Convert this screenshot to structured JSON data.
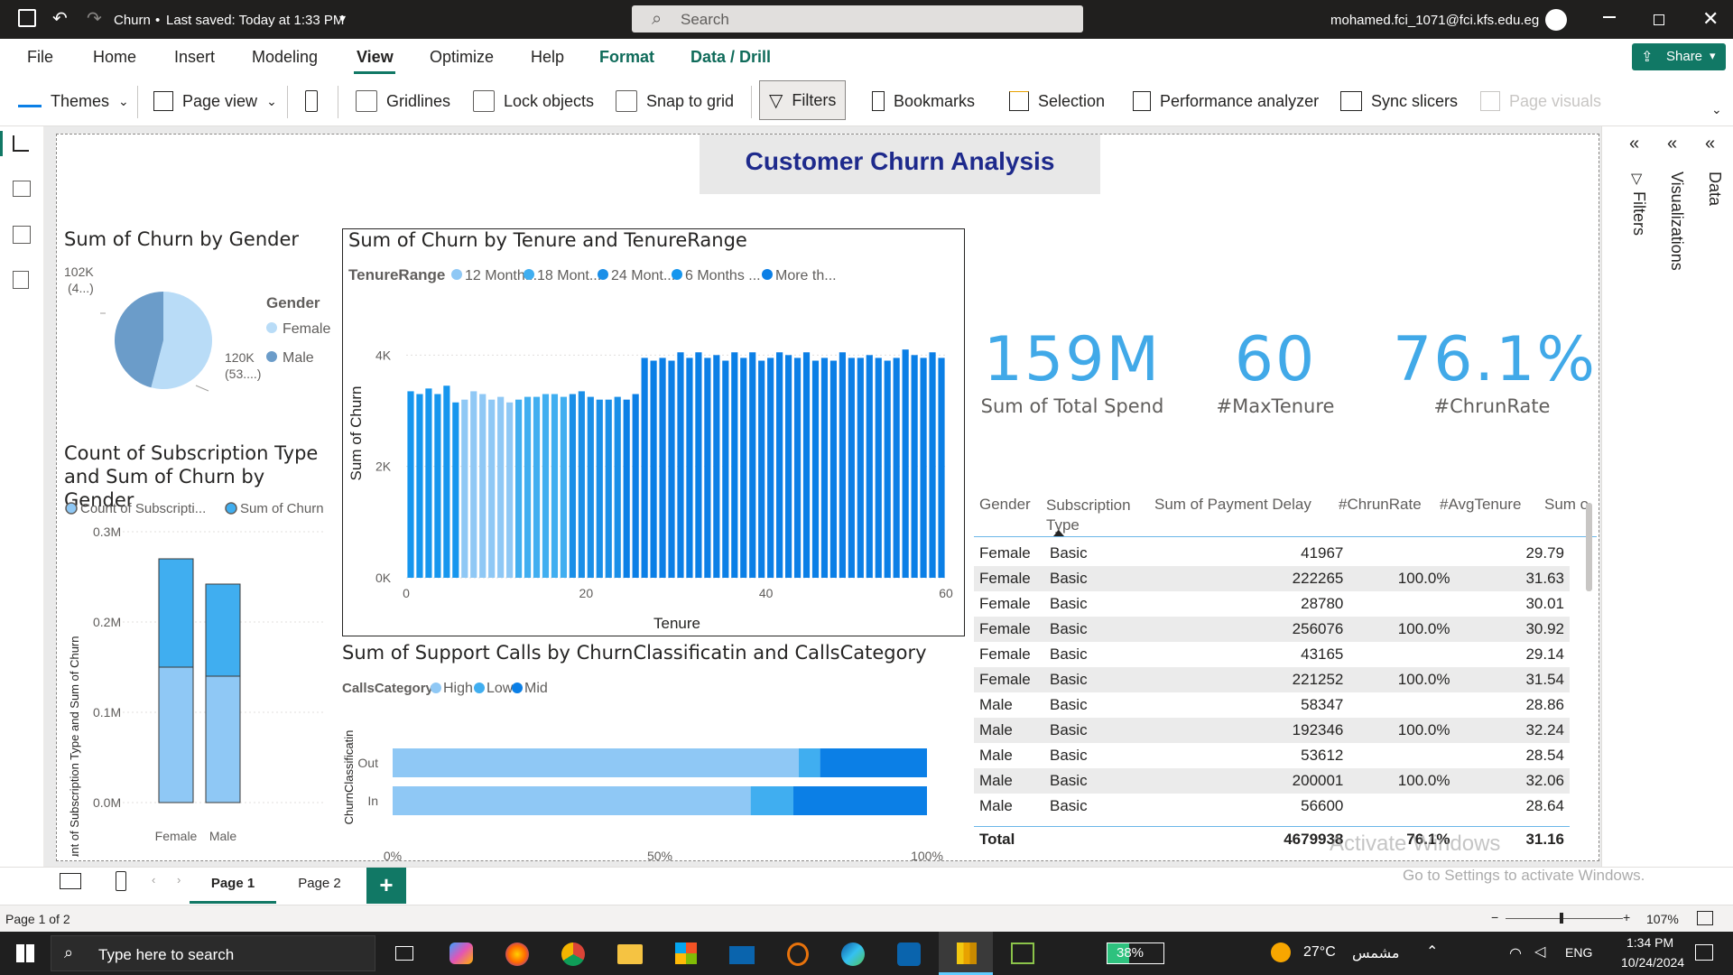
{
  "titlebar": {
    "doc_title": "Churn",
    "saved": "Last saved: Today at 1:33 PM",
    "search_placeholder": "Search",
    "account": "mohamed.fci_1071@fci.kfs.edu.eg"
  },
  "menu": {
    "items": [
      "File",
      "Home",
      "Insert",
      "Modeling",
      "View",
      "Optimize",
      "Help",
      "Format",
      "Data / Drill"
    ],
    "active": "View",
    "share": "Share"
  },
  "ribbon": {
    "themes": "Themes",
    "page_view": "Page view",
    "gridlines": "Gridlines",
    "lock_objects": "Lock objects",
    "snap_to_grid": "Snap to grid",
    "filters": "Filters",
    "bookmarks": "Bookmarks",
    "selection": "Selection",
    "performance_analyzer": "Performance analyzer",
    "sync_slicers": "Sync slicers",
    "page_visuals": "Page visuals"
  },
  "panes": {
    "filters": "Filters",
    "visualizations": "Visualizations",
    "data": "Data"
  },
  "report": {
    "title": "Customer Churn Analysis"
  },
  "cards": [
    {
      "value": "159M",
      "label": "Sum of Total Spend"
    },
    {
      "value": "60",
      "label": "#MaxTenure"
    },
    {
      "value": "76.1%",
      "label": "#ChrunRate"
    }
  ],
  "colors": {
    "light_blue": "#8fc8f5",
    "mid_blue": "#40aef0",
    "blue": "#1a8fe8",
    "deep_blue": "#0b7fe6",
    "pie_female": "#b9dcf7",
    "pie_male": "#6b9cc9",
    "card_value": "#41a9e8",
    "header_green": "#117865"
  },
  "chart_data": [
    {
      "type": "pie",
      "title": "Sum of Churn by Gender",
      "legend_title": "Gender",
      "legend_position": "right",
      "categories": [
        "Female",
        "Male"
      ],
      "values": [
        120000,
        102000
      ],
      "data_labels": [
        "120K (53....)",
        "102K (4...)"
      ]
    },
    {
      "type": "bar",
      "title": "Count of Subscription Type and Sum of Churn by Gender",
      "stacked": true,
      "legend_position": "top-left",
      "categories": [
        "Female",
        "Male"
      ],
      "series": [
        {
          "name": "Count of Subscripti...",
          "values": [
            150000,
            140000
          ]
        },
        {
          "name": "Sum of Churn",
          "values": [
            120000,
            102000
          ]
        }
      ],
      "ylabel": "Count of Subscription Type and Sum of Churn",
      "yticks": [
        "0.0M",
        "0.1M",
        "0.2M",
        "0.3M"
      ],
      "ylim": [
        0,
        300000
      ]
    },
    {
      "type": "bar",
      "title": "Sum of Churn by Tenure and TenureRange",
      "legend_title": "TenureRange",
      "legend_position": "top-left",
      "legend": [
        "12 Month...",
        "18 Mont...",
        "24 Mont...",
        "6 Months ...",
        "More th..."
      ],
      "xlabel": "Tenure",
      "ylabel": "Sum of Churn",
      "xticks": [
        "0",
        "20",
        "40",
        "60"
      ],
      "yticks": [
        "0K",
        "2K",
        "4K"
      ],
      "ylim": [
        0,
        4800
      ],
      "xlim": [
        0,
        60
      ],
      "x": [
        1,
        2,
        3,
        4,
        5,
        6,
        7,
        8,
        9,
        10,
        11,
        12,
        13,
        14,
        15,
        16,
        17,
        18,
        19,
        20,
        21,
        22,
        23,
        24,
        25,
        26,
        27,
        28,
        29,
        30,
        31,
        32,
        33,
        34,
        35,
        36,
        37,
        38,
        39,
        40,
        41,
        42,
        43,
        44,
        45,
        46,
        47,
        48,
        49,
        50,
        51,
        52,
        53,
        54,
        55,
        56,
        57,
        58,
        59,
        60
      ],
      "values": [
        3350,
        3300,
        3400,
        3300,
        3450,
        3150,
        3200,
        3350,
        3300,
        3200,
        3250,
        3150,
        3200,
        3250,
        3250,
        3300,
        3300,
        3250,
        3300,
        3350,
        3250,
        3200,
        3200,
        3250,
        3200,
        3300,
        3950,
        3900,
        3950,
        3900,
        4050,
        3950,
        4050,
        3950,
        4000,
        3900,
        4050,
        3950,
        4050,
        3900,
        3950,
        4050,
        4000,
        3950,
        4050,
        3900,
        3950,
        3900,
        4050,
        3950,
        3950,
        4000,
        3950,
        3900,
        3950,
        4100,
        4000,
        3950,
        4050,
        3950
      ],
      "range_of_bar": [
        "6 Months ...",
        "6 Months ...",
        "6 Months ...",
        "6 Months ...",
        "6 Months ...",
        "6 Months ...",
        "12 Month...",
        "12 Month...",
        "12 Month...",
        "12 Month...",
        "12 Month...",
        "12 Month...",
        "18 Mont...",
        "18 Mont...",
        "18 Mont...",
        "18 Mont...",
        "18 Mont...",
        "18 Mont...",
        "24 Mont...",
        "24 Mont...",
        "24 Mont...",
        "24 Mont...",
        "24 Mont...",
        "24 Mont...",
        "More th...",
        "More th...",
        "More th...",
        "More th...",
        "More th...",
        "More th...",
        "More th...",
        "More th...",
        "More th...",
        "More th...",
        "More th...",
        "More th...",
        "More th...",
        "More th...",
        "More th...",
        "More th...",
        "More th...",
        "More th...",
        "More th...",
        "More th...",
        "More th...",
        "More th...",
        "More th...",
        "More th...",
        "More th...",
        "More th...",
        "More th...",
        "More th...",
        "More th...",
        "More th...",
        "More th...",
        "More th...",
        "More th...",
        "More th...",
        "More th...",
        "More th..."
      ]
    },
    {
      "type": "bar",
      "orientation": "horizontal",
      "stacked_percent": true,
      "title": "Sum of Support Calls by ChurnClassificatin and CallsCategory",
      "legend_title": "CallsCategory",
      "legend_position": "top-left",
      "legend": [
        "High",
        "Low",
        "Mid"
      ],
      "categories": [
        "Out",
        "In"
      ],
      "series": [
        {
          "name": "High",
          "values": [
            76,
            67
          ]
        },
        {
          "name": "Low",
          "values": [
            4,
            8
          ]
        },
        {
          "name": "Mid",
          "values": [
            20,
            25
          ]
        }
      ],
      "ylabel": "ChurnClassificatin",
      "xticks": [
        "0%",
        "50%",
        "100%"
      ],
      "xlim": [
        0,
        100
      ]
    }
  ],
  "table": {
    "headers": [
      "Gender",
      "Subscription Type",
      "Sum of Payment Delay",
      "#ChrunRate",
      "#AvgTenure",
      "Sum o"
    ],
    "rows": [
      [
        "Female",
        "Basic",
        "41967",
        "",
        "29.79"
      ],
      [
        "Female",
        "Basic",
        "222265",
        "100.0%",
        "31.63"
      ],
      [
        "Female",
        "Basic",
        "28780",
        "",
        "30.01"
      ],
      [
        "Female",
        "Basic",
        "256076",
        "100.0%",
        "30.92"
      ],
      [
        "Female",
        "Basic",
        "43165",
        "",
        "29.14"
      ],
      [
        "Female",
        "Basic",
        "221252",
        "100.0%",
        "31.54"
      ],
      [
        "Male",
        "Basic",
        "58347",
        "",
        "28.86"
      ],
      [
        "Male",
        "Basic",
        "192346",
        "100.0%",
        "32.24"
      ],
      [
        "Male",
        "Basic",
        "53612",
        "",
        "28.54"
      ],
      [
        "Male",
        "Basic",
        "200001",
        "100.0%",
        "32.06"
      ],
      [
        "Male",
        "Basic",
        "56600",
        "",
        "28.64"
      ]
    ],
    "total": [
      "Total",
      "",
      "4679938",
      "76.1%",
      "31.16"
    ]
  },
  "watermark": {
    "line1": "Activate Windows",
    "line2": "Go to Settings to activate Windows."
  },
  "pages": {
    "tabs": [
      "Page 1",
      "Page 2"
    ],
    "active": "Page 1",
    "status": "Page 1 of 2",
    "zoom": "107%"
  },
  "taskbar": {
    "search_placeholder": "Type here to search",
    "battery": "38%",
    "weather": "27°C",
    "weather_desc": "مشمس",
    "lang": "ENG",
    "time": "1:34 PM",
    "date": "10/24/2024"
  }
}
